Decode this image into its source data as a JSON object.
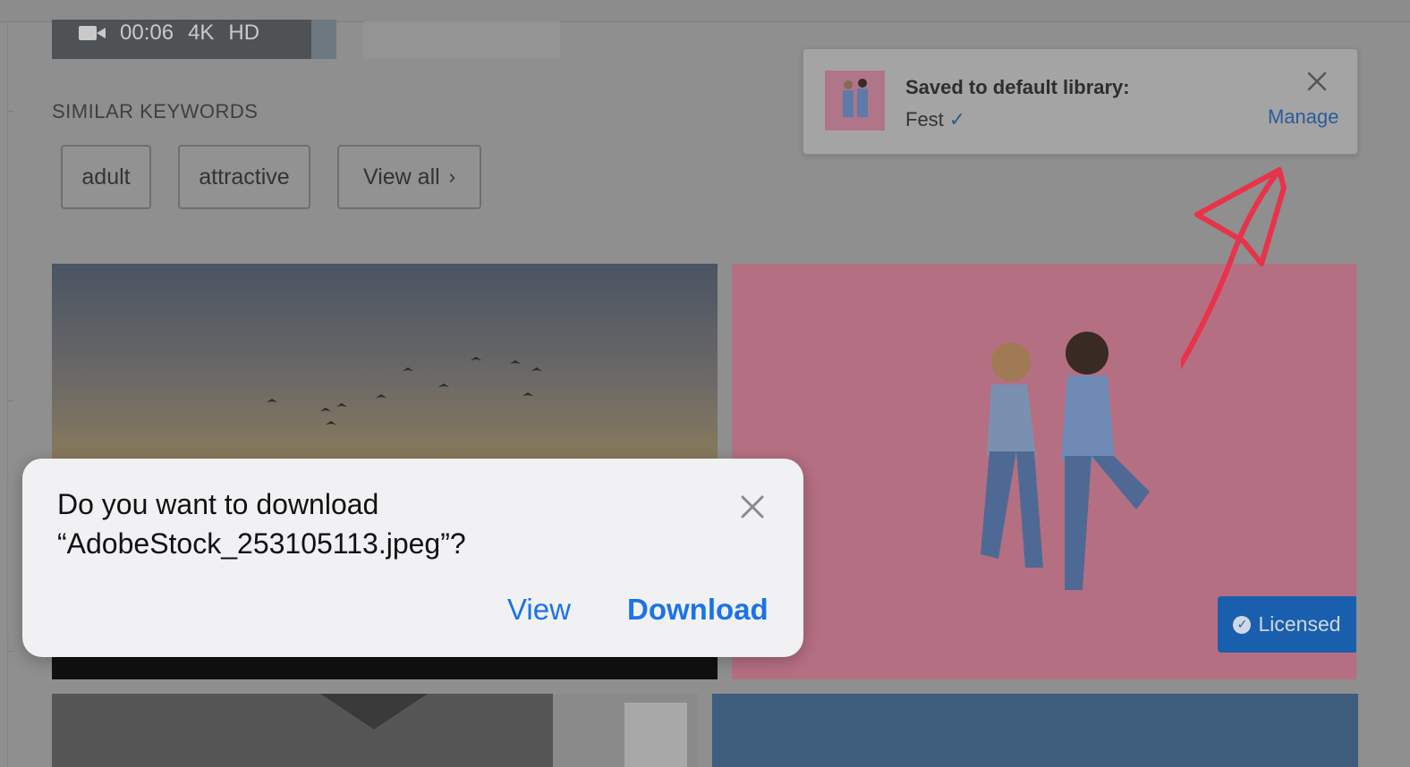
{
  "video": {
    "duration": "00:06",
    "quality": "4K",
    "definition": "HD",
    "icon": "video-camera-icon"
  },
  "similar_keywords": {
    "title": "SIMILAR KEYWORDS",
    "chips": [
      {
        "label": "adult"
      },
      {
        "label": "attractive"
      },
      {
        "label": "View all"
      }
    ],
    "view_all_chevron": "›"
  },
  "licensed_badge": {
    "label": "Licensed",
    "color": "#1a5fae"
  },
  "toast": {
    "title": "Saved to default library:",
    "library": "Fest",
    "check": "✓",
    "manage_label": "Manage",
    "accent": "#2a5c9a"
  },
  "dialog": {
    "question_line1": "Do you want to download",
    "question_line2": "“AdobeStock_253105113.jpeg”?",
    "view_label": "View",
    "download_label": "Download",
    "accent": "#1a73e8"
  },
  "annotation": {
    "color": "#e8334a"
  }
}
